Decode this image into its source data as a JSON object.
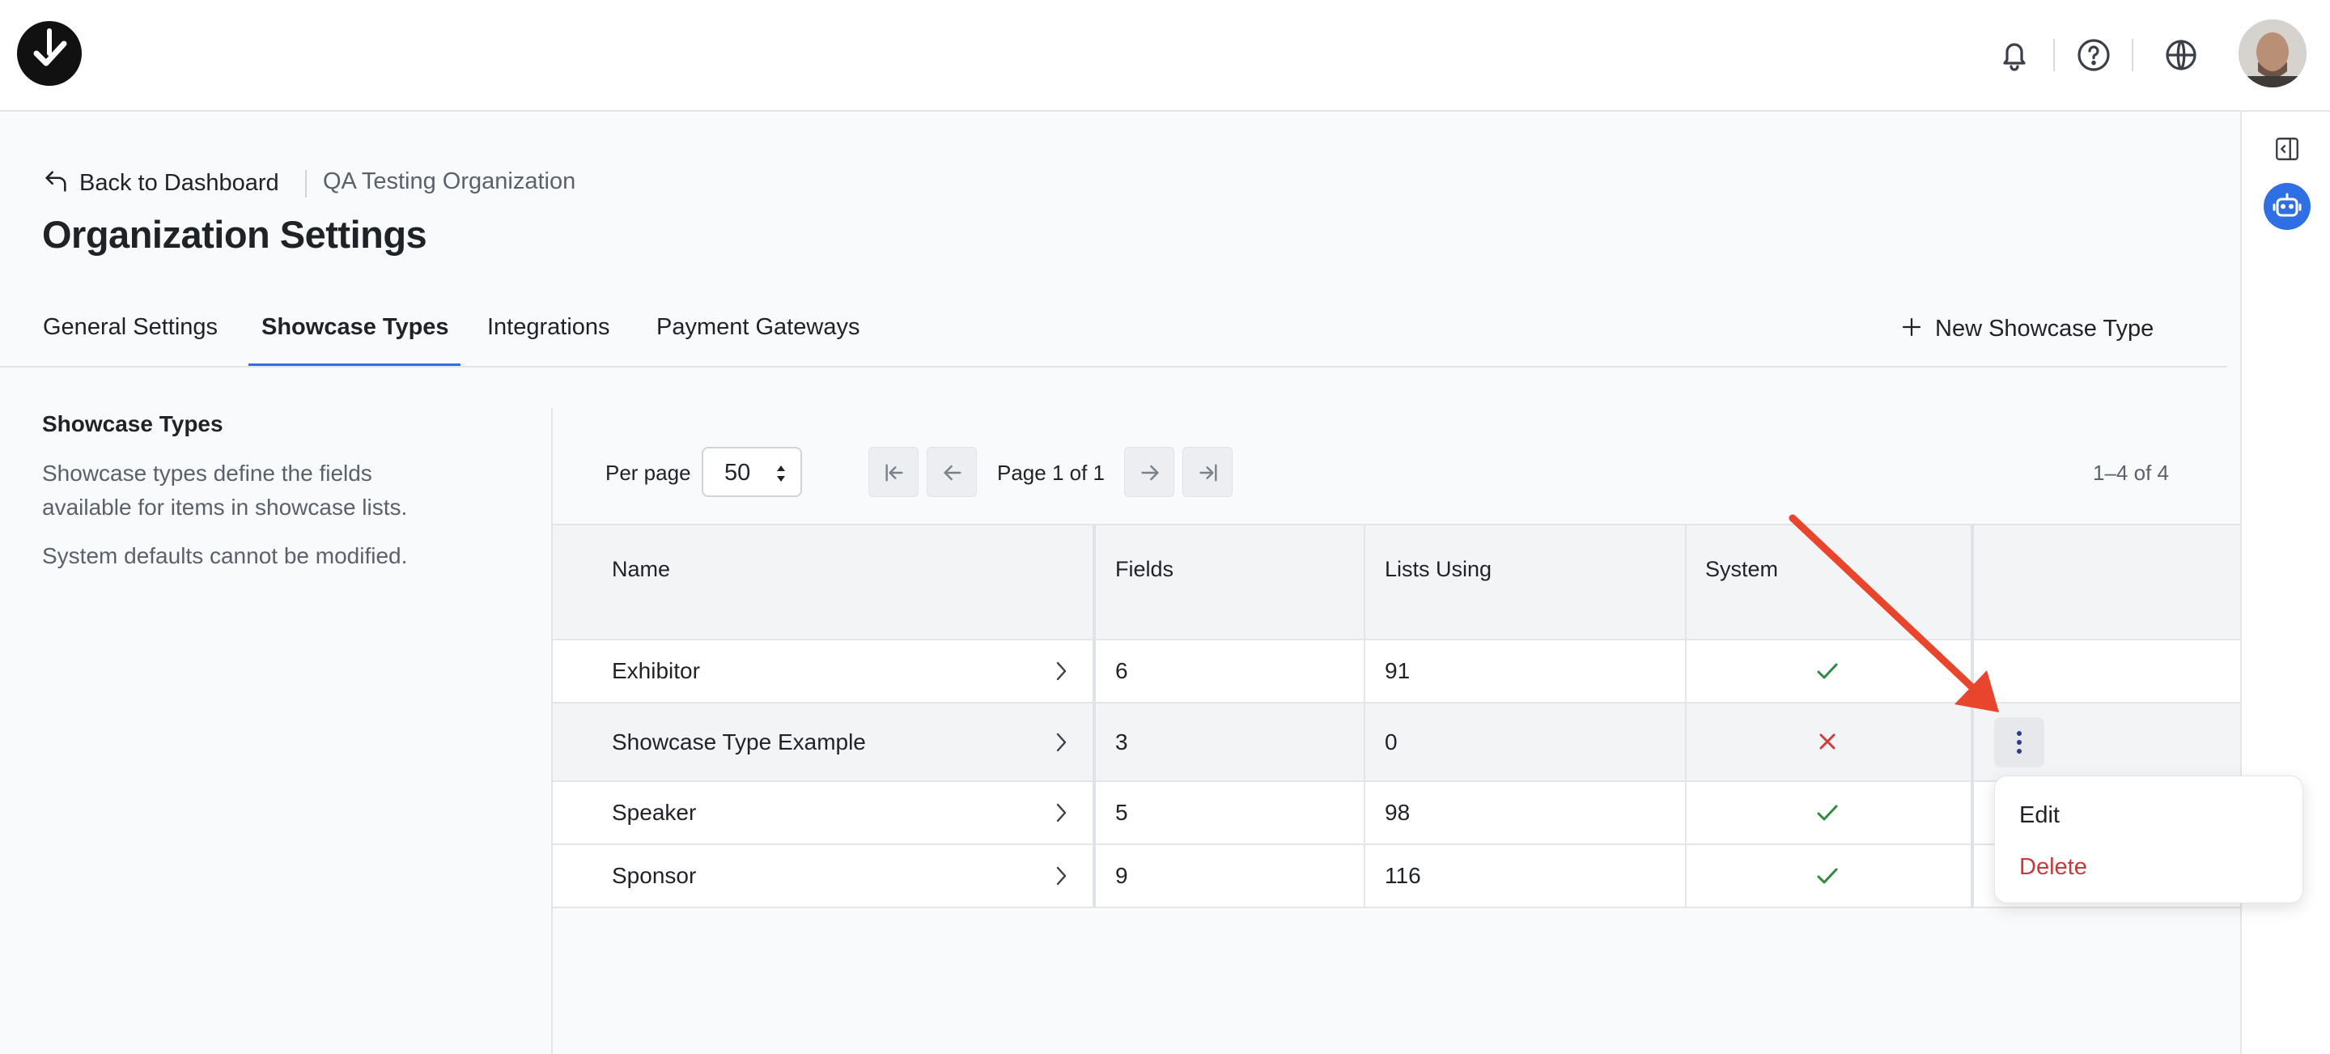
{
  "header": {
    "logo": "brand-logo-icon",
    "icons": [
      "bell-icon",
      "help-circle-icon",
      "globe-icon"
    ],
    "avatar": "user-avatar"
  },
  "breadcrumb": {
    "back_label": "Back to Dashboard",
    "organization": "QA Testing Organization"
  },
  "page_title": "Organization Settings",
  "tabs": [
    {
      "label": "General Settings",
      "active": false
    },
    {
      "label": "Showcase Types",
      "active": true
    },
    {
      "label": "Integrations",
      "active": false
    },
    {
      "label": "Payment Gateways",
      "active": false
    }
  ],
  "new_button_label": "New Showcase Type",
  "sidebar": {
    "title": "Showcase Types",
    "description": "Showcase types define the fields available for items in showcase lists.",
    "note": "System defaults cannot be modified."
  },
  "pagination": {
    "per_page_label": "Per page",
    "per_page_value": "50",
    "page_text": "Page 1 of 1",
    "range_text": "1–4 of 4"
  },
  "table": {
    "columns": [
      "Name",
      "Fields",
      "Lists Using",
      "System",
      ""
    ],
    "rows": [
      {
        "name": "Exhibitor",
        "fields": "6",
        "lists": "91",
        "system": true
      },
      {
        "name": "Showcase Type Example",
        "fields": "3",
        "lists": "0",
        "system": false
      },
      {
        "name": "Speaker",
        "fields": "5",
        "lists": "98",
        "system": true
      },
      {
        "name": "Sponsor",
        "fields": "9",
        "lists": "116",
        "system": true
      }
    ]
  },
  "row_menu": {
    "edit_label": "Edit",
    "delete_label": "Delete"
  },
  "colors": {
    "accent": "#2f6fe4",
    "check": "#2e8b3d",
    "cross": "#d23b3b",
    "delete": "#c53b3b",
    "annotation_arrow": "#e8452c"
  }
}
